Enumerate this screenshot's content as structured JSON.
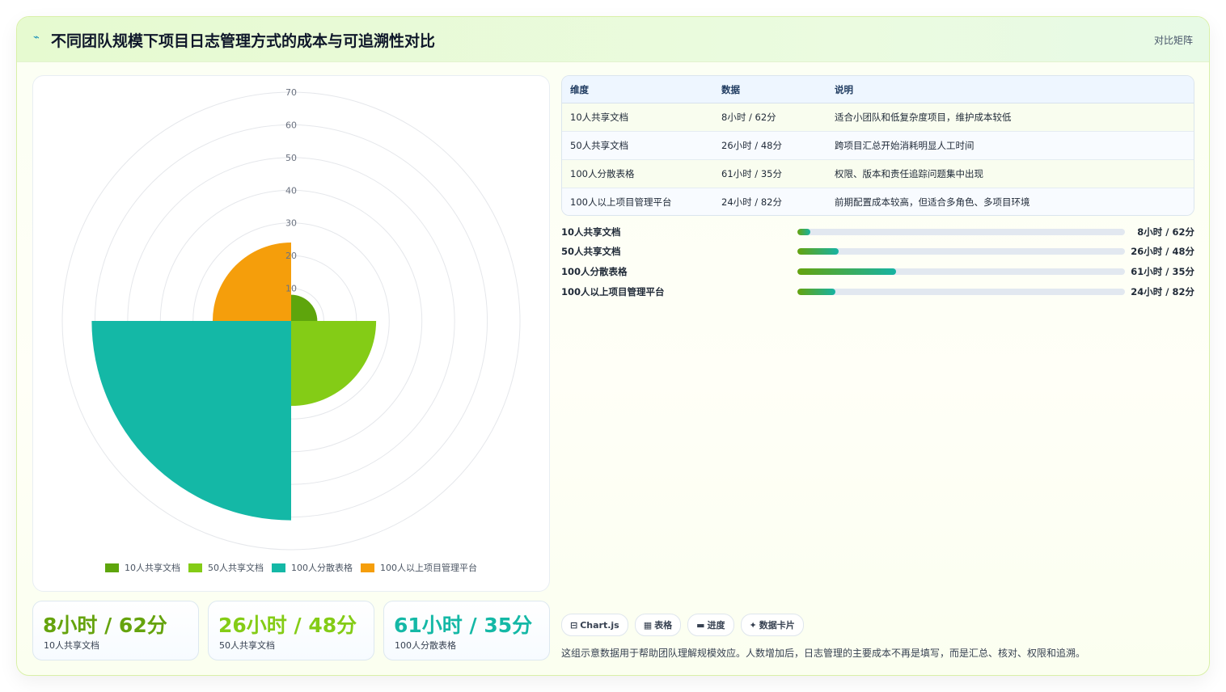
{
  "header": {
    "title": "不同团队规模下项目日志管理方式的成本与可追溯性对比",
    "tag": "对比矩阵"
  },
  "colors": {
    "series": [
      "#5ea50c",
      "#84cc16",
      "#14b8a6",
      "#f59e0b"
    ],
    "stat_values": [
      "#65a30d",
      "#84cc16",
      "#14b8a6"
    ]
  },
  "chart_data": {
    "type": "polarArea",
    "categories": [
      "10人共享文档",
      "50人共享文档",
      "100人分散表格",
      "100人以上项目管理平台"
    ],
    "values": [
      8,
      26,
      61,
      24
    ],
    "r_ticks": [
      10,
      20,
      30,
      40,
      50,
      60,
      70
    ],
    "r_range": [
      0,
      70
    ],
    "legend_position": "bottom",
    "grid": true
  },
  "legend": [
    "10人共享文档",
    "50人共享文档",
    "100人分散表格",
    "100人以上项目管理平台"
  ],
  "table": {
    "headers": [
      "维度",
      "数据",
      "说明"
    ],
    "rows": [
      {
        "dim": "10人共享文档",
        "data": "8小时 / 62分",
        "note": "适合小团队和低复杂度项目，维护成本较低"
      },
      {
        "dim": "50人共享文档",
        "data": "26小时 / 48分",
        "note": "跨项目汇总开始消耗明显人工时间"
      },
      {
        "dim": "100人分散表格",
        "data": "61小时 / 35分",
        "note": "权限、版本和责任追踪问题集中出现"
      },
      {
        "dim": "100人以上项目管理平台",
        "data": "24小时 / 82分",
        "note": "前期配置成本较高，但适合多角色、多项目环境"
      }
    ]
  },
  "progress": [
    {
      "label": "10人共享文档",
      "value": "8小时 / 62分",
      "fraction": 0.039
    },
    {
      "label": "50人共享文档",
      "value": "26小时 / 48分",
      "fraction": 0.125
    },
    {
      "label": "100人分散表格",
      "value": "61小时 / 35分",
      "fraction": 0.3
    },
    {
      "label": "100人以上项目管理平台",
      "value": "24小时 / 82分",
      "fraction": 0.115
    }
  ],
  "stats": [
    {
      "value": "8小时 / 62分",
      "label": "10人共享文档"
    },
    {
      "value": "26小时 / 48分",
      "label": "50人共享文档"
    },
    {
      "value": "61小时 / 35分",
      "label": "100人分散表格"
    }
  ],
  "chips": [
    {
      "icon": "⊟",
      "label": "Chart.js"
    },
    {
      "icon": "▦",
      "label": "表格"
    },
    {
      "icon": "▬",
      "label": "进度"
    },
    {
      "icon": "✦",
      "label": "数据卡片"
    }
  ],
  "footnote": "这组示意数据用于帮助团队理解规模效应。人数增加后，日志管理的主要成本不再是填写，而是汇总、核对、权限和追溯。"
}
